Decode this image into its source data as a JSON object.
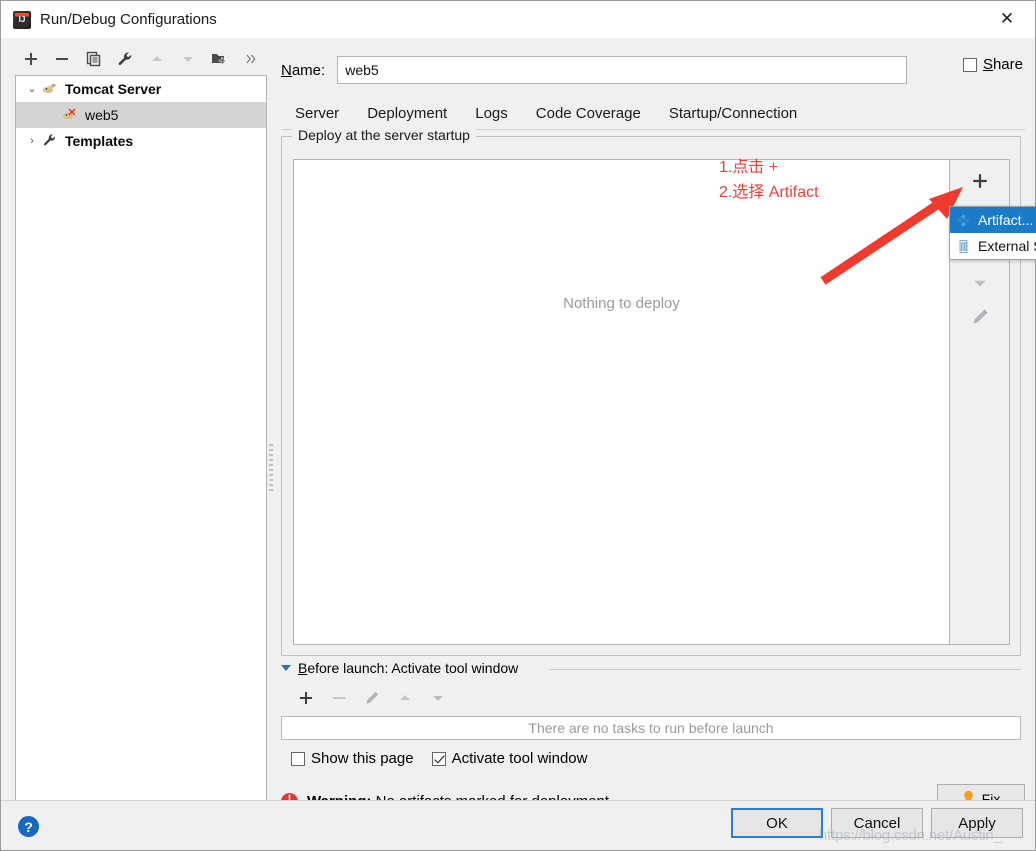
{
  "window": {
    "title": "Run/Debug Configurations",
    "app_icon": "intellij-idea-icon",
    "close_label": "✕"
  },
  "left_toolbar": {
    "buttons": [
      {
        "name": "add-configuration-button",
        "icon": "plus-icon",
        "enabled": true
      },
      {
        "name": "remove-configuration-button",
        "icon": "minus-icon",
        "enabled": true
      },
      {
        "name": "copy-configuration-button",
        "icon": "copy-icon",
        "enabled": true
      },
      {
        "name": "edit-templates-button",
        "icon": "wrench-icon",
        "enabled": true
      },
      {
        "name": "move-up-button",
        "icon": "arrow-up-icon",
        "enabled": false
      },
      {
        "name": "move-down-button",
        "icon": "arrow-down-icon",
        "enabled": false
      },
      {
        "name": "new-folder-button",
        "icon": "folder-add-icon",
        "enabled": true
      },
      {
        "name": "more-options-button",
        "icon": "chevron-double-right-icon",
        "enabled": true
      }
    ]
  },
  "tree": {
    "items": [
      {
        "label": "Tomcat Server",
        "icon": "tomcat-icon",
        "expanded": true,
        "twisty": "⌄",
        "selected": false,
        "depth": 0,
        "bold": true
      },
      {
        "label": "web5",
        "icon": "tomcat-run-icon",
        "expanded": false,
        "twisty": "",
        "selected": true,
        "depth": 1,
        "bold": false
      },
      {
        "label": "Templates",
        "icon": "wrench-icon",
        "expanded": false,
        "twisty": "›",
        "selected": false,
        "depth": 0,
        "bold": true
      }
    ]
  },
  "name_field": {
    "label_prefix": "N",
    "label_rest": "ame:",
    "value": "web5",
    "placeholder": "Name"
  },
  "share": {
    "label_prefix": "S",
    "label_rest": "hare",
    "checked": false
  },
  "tabs": [
    {
      "label": "Server",
      "active": false
    },
    {
      "label": "Deployment",
      "active": true
    },
    {
      "label": "Logs",
      "active": false
    },
    {
      "label": "Code Coverage",
      "active": false
    },
    {
      "label": "Startup/Connection",
      "active": false
    }
  ],
  "deploy": {
    "group_title": "Deploy at the server startup",
    "empty_text": "Nothing to deploy",
    "side_buttons": [
      {
        "name": "deploy-add-button",
        "icon": "plus-icon",
        "enabled": true
      },
      {
        "name": "deploy-remove-button",
        "icon": "minus-icon",
        "enabled": false
      },
      {
        "name": "deploy-move-up-button",
        "icon": "arrow-up-icon",
        "enabled": false
      },
      {
        "name": "deploy-move-down-button",
        "icon": "arrow-down-icon",
        "enabled": false
      },
      {
        "name": "deploy-edit-button",
        "icon": "pencil-icon",
        "enabled": false
      }
    ]
  },
  "popup_menu": {
    "items": [
      {
        "label": "Artifact...",
        "icon": "artifact-icon",
        "selected": true
      },
      {
        "label": "External Source...",
        "icon": "external-source-icon",
        "selected": false
      }
    ]
  },
  "annotations": {
    "step1": "1.点击 +",
    "step2": "2.选择 Artifact",
    "arrow_color": "#f03a2e"
  },
  "before_launch": {
    "title_prefix": "B",
    "title_rest": "efore launch: Activate tool window",
    "toolbar": [
      {
        "name": "before-launch-add-button",
        "icon": "plus-icon",
        "enabled": true
      },
      {
        "name": "before-launch-remove-button",
        "icon": "minus-icon",
        "enabled": false
      },
      {
        "name": "before-launch-edit-button",
        "icon": "pencil-icon",
        "enabled": false
      },
      {
        "name": "before-launch-move-up-button",
        "icon": "arrow-up-icon",
        "enabled": false
      },
      {
        "name": "before-launch-move-down-button",
        "icon": "arrow-down-icon",
        "enabled": false
      }
    ],
    "empty_text": "There are no tasks to run before launch",
    "show_this_page": {
      "label": "Show this page",
      "checked": false
    },
    "activate_tool_window": {
      "label": "Activate tool window",
      "checked": true
    }
  },
  "warning": {
    "prefix": "Warning:",
    "message": " No artifacts marked for deployment",
    "icon": "warning-icon",
    "fix_label": "Fix",
    "fix_icon": "lightbulb-icon",
    "color": "#dc3a36"
  },
  "footer": {
    "help_label": "?",
    "buttons": [
      {
        "label": "OK",
        "default": true,
        "name": "ok-button"
      },
      {
        "label": "Cancel",
        "default": false,
        "name": "cancel-button"
      },
      {
        "label": "Apply",
        "default": false,
        "name": "apply-button"
      }
    ]
  },
  "watermark": {
    "text": "https://blog.csdn.net/Austin_"
  },
  "colors": {
    "accent": "#3b78c3",
    "selection": "#1a7bc9",
    "annotation_red": "#e8403a",
    "warning_red": "#dc3a36",
    "help_blue": "#1668c1"
  }
}
